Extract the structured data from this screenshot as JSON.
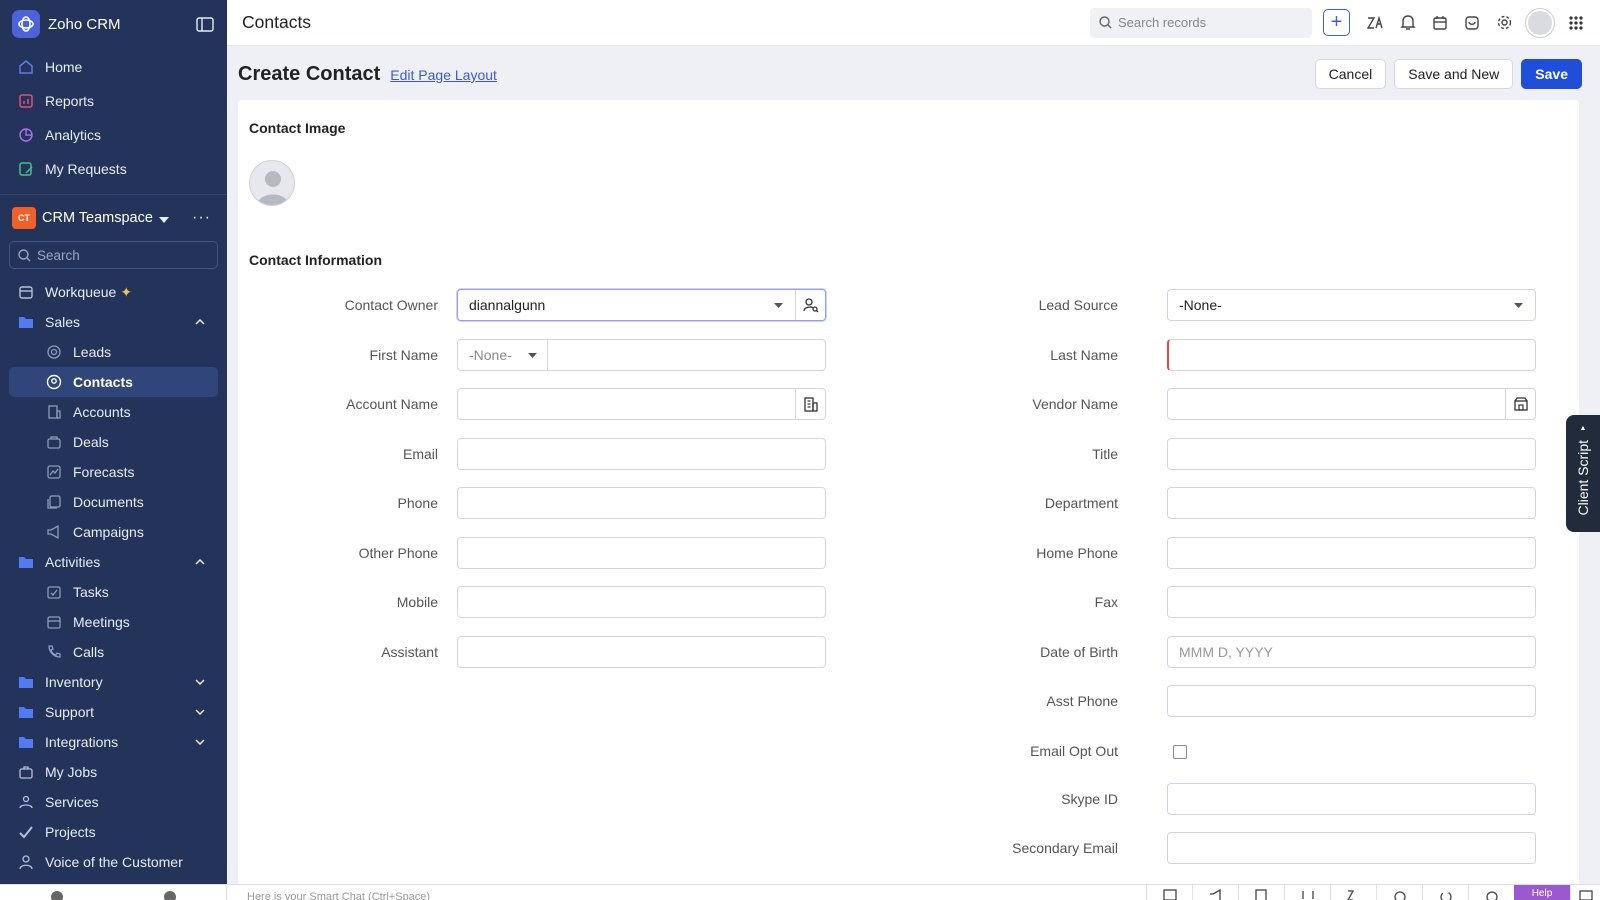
{
  "sidebar": {
    "app_name": "Zoho CRM",
    "top_items": [
      {
        "label": "Home"
      },
      {
        "label": "Reports"
      },
      {
        "label": "Analytics"
      },
      {
        "label": "My Requests"
      }
    ],
    "teamspace": {
      "badge": "CT",
      "name": "CRM Teamspace"
    },
    "search_placeholder": "Search",
    "workqueue": "Workqueue",
    "sales": {
      "label": "Sales",
      "items": [
        "Leads",
        "Contacts",
        "Accounts",
        "Deals",
        "Forecasts",
        "Documents",
        "Campaigns"
      ]
    },
    "activities": {
      "label": "Activities",
      "items": [
        "Tasks",
        "Meetings",
        "Calls"
      ]
    },
    "inventory": "Inventory",
    "support": "Support",
    "integrations": "Integrations",
    "bottom_items": [
      "My Jobs",
      "Services",
      "Projects",
      "Voice of the Customer"
    ]
  },
  "topbar": {
    "title": "Contacts",
    "search_placeholder": "Search records",
    "plus": "+"
  },
  "page": {
    "title": "Create Contact",
    "edit_layout": "Edit Page Layout",
    "cancel": "Cancel",
    "save_and_new": "Save and New",
    "save": "Save"
  },
  "form": {
    "image_section": "Contact Image",
    "info_section": "Contact Information",
    "left": [
      {
        "label": "Contact Owner",
        "value": "diannalgunn"
      },
      {
        "label": "First Name",
        "salutation": "-None-",
        "value": ""
      },
      {
        "label": "Account Name",
        "value": ""
      },
      {
        "label": "Email",
        "value": ""
      },
      {
        "label": "Phone",
        "value": ""
      },
      {
        "label": "Other Phone",
        "value": ""
      },
      {
        "label": "Mobile",
        "value": ""
      },
      {
        "label": "Assistant",
        "value": ""
      }
    ],
    "right": [
      {
        "label": "Lead Source",
        "value": "-None-"
      },
      {
        "label": "Last Name",
        "value": ""
      },
      {
        "label": "Vendor Name",
        "value": ""
      },
      {
        "label": "Title",
        "value": ""
      },
      {
        "label": "Department",
        "value": ""
      },
      {
        "label": "Home Phone",
        "value": ""
      },
      {
        "label": "Fax",
        "value": ""
      },
      {
        "label": "Date of Birth",
        "placeholder": "MMM D, YYYY"
      },
      {
        "label": "Asst Phone",
        "value": ""
      },
      {
        "label": "Email Opt Out",
        "checked": false
      },
      {
        "label": "Skype ID",
        "value": ""
      },
      {
        "label": "Secondary Email",
        "value": ""
      }
    ]
  },
  "client_script": "Client Script",
  "bottombar": {
    "chat_placeholder": "Here is your Smart Chat (Ctrl+Space)",
    "help": "Help"
  },
  "colors": {
    "sidebar": "#23335a",
    "primary": "#1f4ed8",
    "required": "#e04a3f",
    "help": "#9b59d0"
  }
}
